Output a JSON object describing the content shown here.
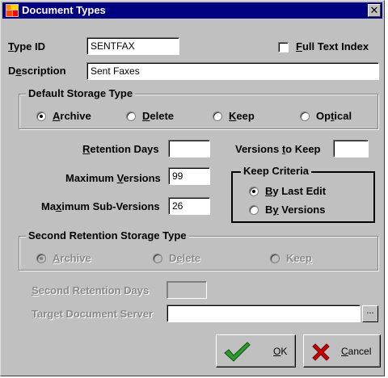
{
  "window": {
    "title": "Document Types",
    "close_glyph": "✕"
  },
  "type_id": {
    "label": "Type ID",
    "value": "SENTFAX"
  },
  "full_text_index": {
    "label": "Full Text Index",
    "checked": false
  },
  "description": {
    "label": "Description",
    "value": "Sent Faxes"
  },
  "default_storage": {
    "title": "Default Storage Type",
    "options": [
      {
        "label": "Archive",
        "checked": true
      },
      {
        "label": "Delete",
        "checked": false
      },
      {
        "label": "Keep",
        "checked": false
      },
      {
        "label": "Optical",
        "checked": false
      }
    ]
  },
  "retention_days": {
    "label": "Retention Days",
    "value": ""
  },
  "versions_to_keep": {
    "label": "Versions to Keep",
    "value": ""
  },
  "maximum_versions": {
    "label": "Maximum Versions",
    "value": "99"
  },
  "maximum_sub_versions": {
    "label": "Maximum Sub-Versions",
    "value": "26"
  },
  "keep_criteria": {
    "title": "Keep Criteria",
    "options": [
      {
        "label": "By Last Edit",
        "checked": true
      },
      {
        "label": "By Versions",
        "checked": false
      }
    ]
  },
  "second_retention": {
    "title": "Second Retention Storage Type",
    "options": [
      {
        "label": "Archive",
        "checked": true
      },
      {
        "label": "Delete",
        "checked": false
      },
      {
        "label": "Keep",
        "checked": false
      }
    ]
  },
  "second_retention_days": {
    "label": "Second Retention Days",
    "value": ""
  },
  "target_document_server": {
    "label": "Target Document Server",
    "value": "",
    "browse_label": "..."
  },
  "buttons": {
    "ok_label": "OK",
    "cancel_label": "Cancel"
  },
  "colors": {
    "title_bar": "#000080",
    "window_face": "#c0c0c0",
    "ok_check": "#2e9a2e",
    "cancel_x": "#cc0000"
  }
}
